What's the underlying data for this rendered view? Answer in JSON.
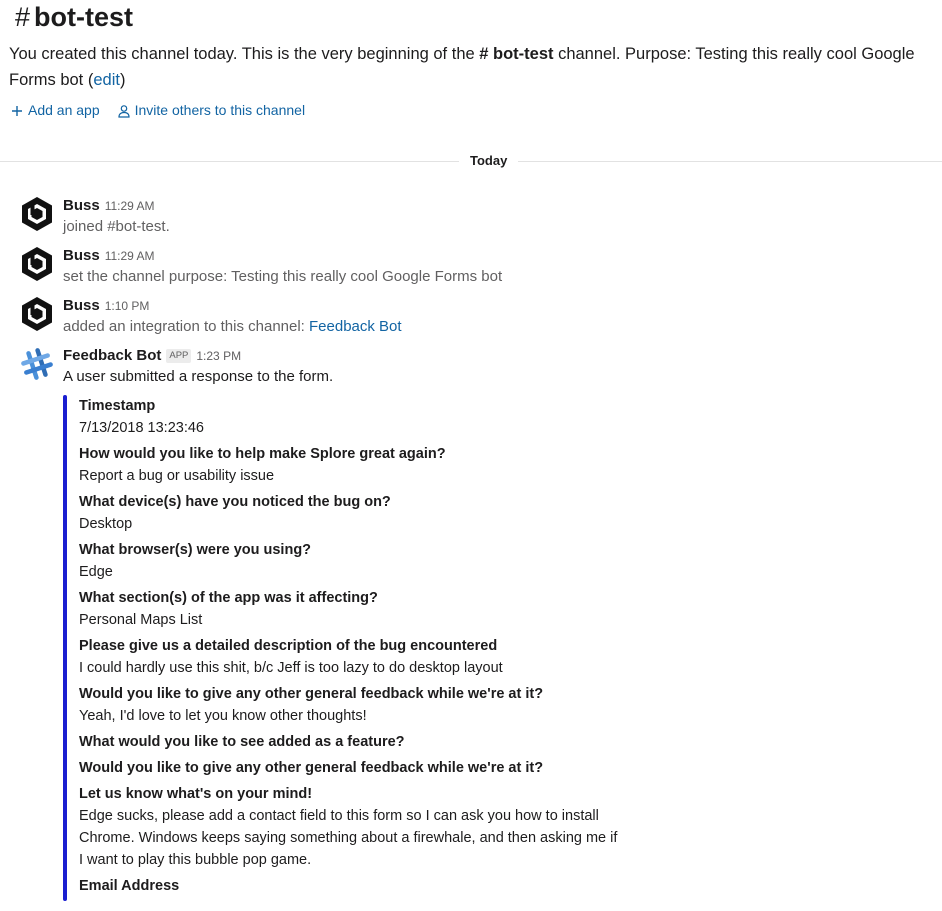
{
  "channel": {
    "hash": "#",
    "name": "bot-test",
    "intro_prefix": "You created this channel today. This is the very beginning of the ",
    "intro_channel_ref": "# bot-test",
    "intro_suffix": " channel. Purpose: Testing this really cool Google Forms bot (",
    "edit_label": "edit",
    "intro_end": ")"
  },
  "actions": {
    "add_app": "Add an app",
    "invite": "Invite others to this channel"
  },
  "divider": {
    "label": "Today"
  },
  "messages": [
    {
      "sender": "Buss",
      "time": "11:29 AM",
      "text": "joined #bot-test."
    },
    {
      "sender": "Buss",
      "time": "11:29 AM",
      "text": "set the channel purpose: Testing this really cool Google Forms bot"
    },
    {
      "sender": "Buss",
      "time": "1:10 PM",
      "text_prefix": "added an integration to this channel: ",
      "link": "Feedback Bot"
    },
    {
      "sender": "Feedback Bot",
      "badge": "APP",
      "time": "1:23 PM",
      "text": "A user submitted a response to the form."
    }
  ],
  "attachment": {
    "accent_color": "#1a1ed0",
    "fields": [
      {
        "title": "Timestamp",
        "value": "7/13/2018 13:23:46"
      },
      {
        "title": "How would you like to help make Splore great again?",
        "value": "Report a bug or usability issue"
      },
      {
        "title": "What device(s) have you noticed the bug on?",
        "value": "Desktop"
      },
      {
        "title": "What browser(s) were you using?",
        "value": "Edge"
      },
      {
        "title": "What section(s) of the app was it affecting?",
        "value": "Personal Maps List"
      },
      {
        "title": "Please give us a detailed description of the bug encountered",
        "value": "I could hardly use this shit, b/c Jeff is too lazy to do desktop layout"
      },
      {
        "title": "Would you like to give any other general feedback while we're at it?",
        "value": "Yeah, I'd love to let you know other thoughts!"
      },
      {
        "title": "What would you like to see added as a feature?",
        "value": ""
      },
      {
        "title": "Would you like to give any other general feedback while we're at it?",
        "value": ""
      },
      {
        "title": "Let us know what's on your mind!",
        "value_lines": [
          "Edge sucks, please add a contact field to this form so I can ask you how to install",
          "Chrome. Windows keeps saying something about a firewhale, and then asking me if",
          "I want to play this bubble pop game."
        ]
      },
      {
        "title": "Email Address",
        "value": ""
      }
    ]
  },
  "icons": {
    "plus": "plus-icon",
    "person": "person-icon",
    "buss_avatar": "hexagon-b-logo-icon",
    "bot_avatar": "slack-hash-logo-icon"
  }
}
